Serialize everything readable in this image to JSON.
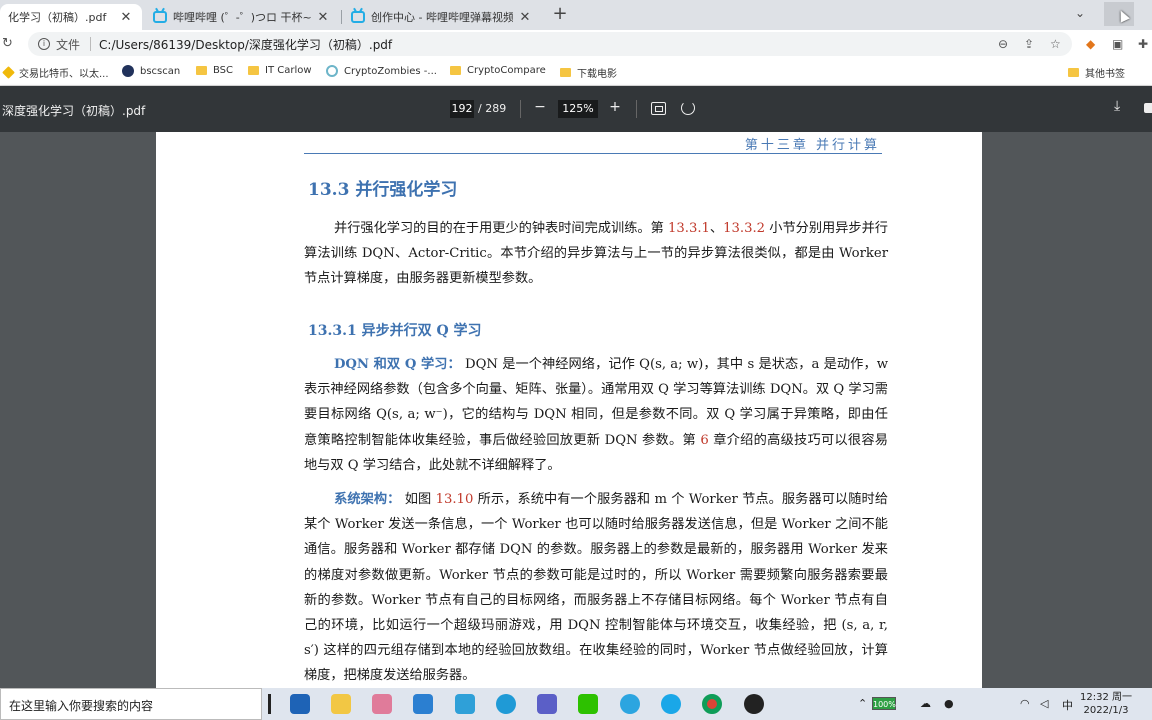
{
  "tabs": [
    {
      "title": "化学习（初稿）.pdf",
      "active": true
    },
    {
      "title": "哔哩哔哩 (゜-゜)つロ 干杯~-bili",
      "active": false
    },
    {
      "title": "创作中心 - 哔哩哔哩弹幕视频网",
      "active": false
    }
  ],
  "addressbar": {
    "protocol_label": "文件",
    "url": "C:/Users/86139/Desktop/深度强化学习（初稿）.pdf"
  },
  "bookmarks": [
    {
      "label": "交易比特币、以太...",
      "icon": "binance-icon"
    },
    {
      "label": "bscscan",
      "icon": "bscscan-icon"
    },
    {
      "label": "BSC",
      "icon": "folder-icon"
    },
    {
      "label": "IT Carlow",
      "icon": "folder-icon"
    },
    {
      "label": "CryptoZombies -...",
      "icon": "cryptozombies-icon"
    },
    {
      "label": "CryptoCompare",
      "icon": "folder-icon"
    },
    {
      "label": "下载电影",
      "icon": "folder-icon"
    }
  ],
  "bookmarks_other": "其他书签",
  "pdf_toolbar": {
    "title": "深度强化学习（初稿）.pdf",
    "current_page": "192",
    "total_pages": "/ 289",
    "zoom": "125%"
  },
  "page": {
    "chapter_header": "第十三章 并行计算",
    "section_title": "13.3  并行强化学习",
    "intro": {
      "t1": "并行强化学习的目的在于用更少的钟表时间完成训练。第 ",
      "ref1": "13.3.1",
      "t2": "、",
      "ref2": "13.3.2",
      "t3": " 小节分别用异步并行算法训练 DQN、Actor-Critic。本节介绍的异步算法与上一节的异步算法很类似，都是由 Worker 节点计算梯度，由服务器更新模型参数。"
    },
    "subsection_title": "13.3.1  异步并行双 Q 学习",
    "dqn_para": {
      "label": "DQN 和双 Q 学习：",
      "t1": " DQN 是一个神经网络，记作 Q(s, a; w)，其中 s 是状态，a 是动作，w 表示神经网络参数（包含多个向量、矩阵、张量）。通常用双 Q 学习等算法训练 DQN。双 Q 学习需要目标网络 Q(s, a; w⁻)，它的结构与 DQN 相同，但是参数不同。双 Q 学习属于异策略，即由任意策略控制智能体收集经验，事后做经验回放更新 DQN 参数。第 ",
      "ref": "6",
      "t2": " 章介绍的高级技巧可以很容易地与双 Q 学习结合，此处就不详细解释了。"
    },
    "arch_para": {
      "label": "系统架构：",
      "t1": " 如图 ",
      "ref": "13.10",
      "t2": " 所示，系统中有一个服务器和 m 个 Worker 节点。服务器可以随时给某个 Worker 发送一条信息，一个 Worker 也可以随时给服务器发送信息，但是 Worker 之间不能通信。服务器和 Worker 都存储 DQN 的参数。服务器上的参数是最新的，服务器用 Worker 发来的梯度对参数做更新。Worker 节点的参数可能是过时的，所以 Worker 需要频繁向服务器索要最新的参数。Worker 节点有自己的目标网络，而服务器上不存储目标网络。每个 Worker 节点有自己的环境，比如运行一个超级玛丽游戏，用 DQN 控制智能体与环境交互，收集经验，把 (s, a, r, s′) 这样的四元组存储到本地的经验回放数组。在收集经验的同时，Worker 节点做经验回放，计算梯度，把梯度发送给服务器。"
    }
  },
  "taskbar": {
    "search_placeholder": "在这里输入你要搜索的内容",
    "battery": "100%",
    "ime": "中",
    "time": "12:32 周一",
    "date": "2022/1/3"
  },
  "colors": {
    "heading_blue": "#3e72b0",
    "ref_red": "#c0392b",
    "pdf_toolbar": "#323639",
    "viewer_bg": "#525659"
  }
}
